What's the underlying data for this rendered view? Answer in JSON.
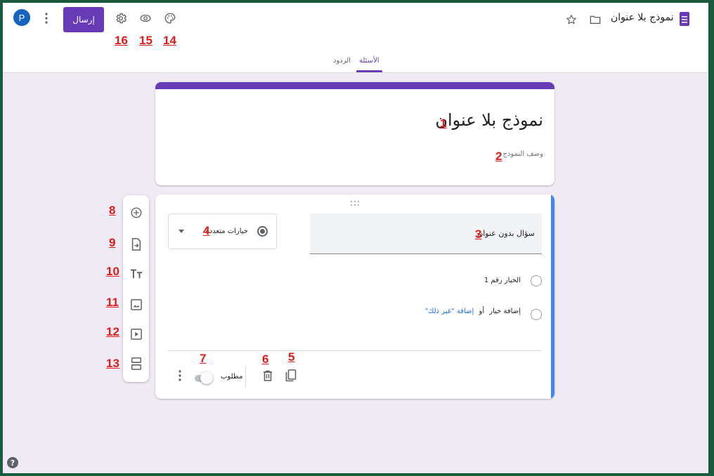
{
  "app": {
    "doc_title": "نموذج بلا عنوان",
    "send_label": "إرسال",
    "avatar_letter": "P"
  },
  "tabs": [
    {
      "label": "الأسئلة",
      "active": true
    },
    {
      "label": "الردود",
      "active": false
    }
  ],
  "form": {
    "title": "نموذج بلا عنوان",
    "description": "وصف النموذج"
  },
  "question": {
    "title": "سؤال بدون عنوان",
    "type_label": "خيارات متعددة",
    "option_1": "الخيار رقم 1",
    "add_option": "إضافة خيار",
    "or_text": "أو",
    "add_other": "إضافة \"غير ذلك\"",
    "required_label": "مطلوب"
  },
  "annotations": {
    "a1": "1",
    "a2": "2",
    "a3": "3",
    "a4": "4",
    "a5": "5",
    "a6": "6",
    "a7": "7",
    "a8": "8",
    "a9": "9",
    "a10": "10",
    "a11": "11",
    "a12": "12",
    "a13": "13",
    "a14": "14",
    "a15": "15",
    "a16": "16"
  },
  "icons": [
    "forms-icon",
    "folder-icon",
    "star-icon",
    "palette-icon",
    "eye-icon",
    "gear-icon",
    "more-vert-icon",
    "add-circle-icon",
    "import-icon",
    "text-icon",
    "image-icon",
    "video-icon",
    "section-icon",
    "copy-icon",
    "trash-icon",
    "help-icon"
  ],
  "colors": {
    "accent": "#673ab7",
    "question_bar": "#4285f4",
    "annotation": "#e01b1b",
    "frame": "#1a5a3f"
  }
}
